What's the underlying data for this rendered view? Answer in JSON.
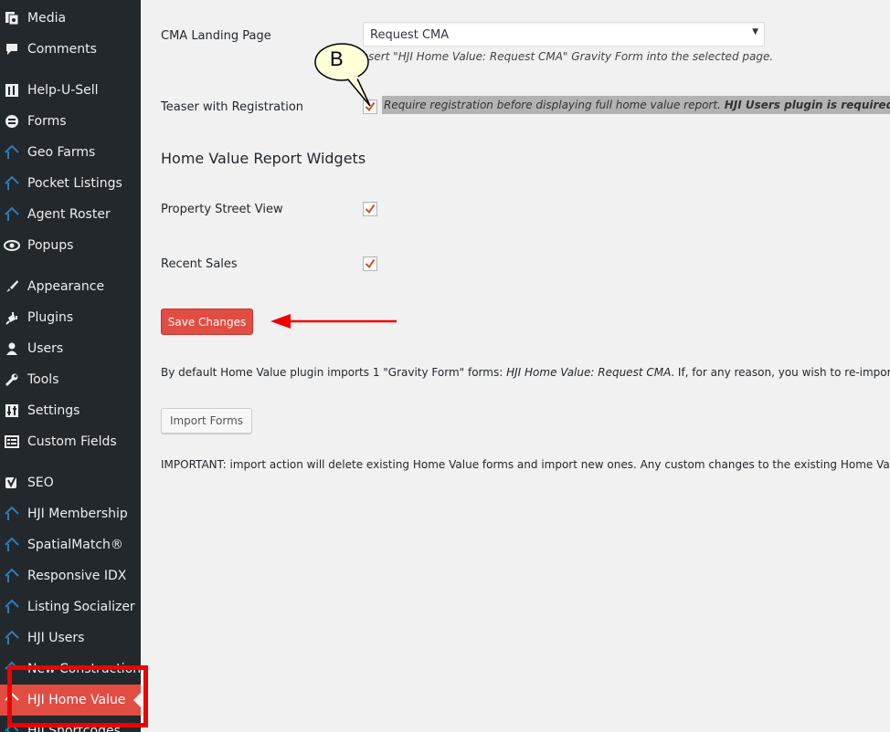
{
  "sidebar": {
    "items": [
      {
        "label": "Media",
        "icon": "media-icon"
      },
      {
        "label": "Comments",
        "icon": "comments-icon"
      },
      {
        "label": "Help-U-Sell",
        "icon": "help-u-sell-icon"
      },
      {
        "label": "Forms",
        "icon": "forms-icon"
      },
      {
        "label": "Geo Farms",
        "icon": "house-icon"
      },
      {
        "label": "Pocket Listings",
        "icon": "house-icon"
      },
      {
        "label": "Agent Roster",
        "icon": "house-icon"
      },
      {
        "label": "Popups",
        "icon": "popups-icon"
      },
      {
        "label": "Appearance",
        "icon": "appearance-icon"
      },
      {
        "label": "Plugins",
        "icon": "plugins-icon"
      },
      {
        "label": "Users",
        "icon": "users-icon"
      },
      {
        "label": "Tools",
        "icon": "tools-icon"
      },
      {
        "label": "Settings",
        "icon": "settings-icon"
      },
      {
        "label": "Custom Fields",
        "icon": "custom-fields-icon"
      },
      {
        "label": "SEO",
        "icon": "seo-icon"
      },
      {
        "label": "HJI Membership",
        "icon": "house-icon"
      },
      {
        "label": "SpatialMatch®",
        "icon": "house-icon"
      },
      {
        "label": "Responsive IDX",
        "icon": "house-icon"
      },
      {
        "label": "Listing Socializer",
        "icon": "house-icon"
      },
      {
        "label": "HJI Users",
        "icon": "house-icon"
      },
      {
        "label": "New Construction",
        "icon": "house-icon"
      },
      {
        "label": "HJI Home Value",
        "icon": "house-icon",
        "active": true
      },
      {
        "label": "HJI Shortcodes",
        "icon": "house-icon"
      }
    ]
  },
  "main": {
    "cma_label": "CMA Landing Page",
    "cma_select_value": "Request CMA",
    "cma_desc": "Insert \"HJI Home Value: Request CMA\" Gravity Form into the selected page.",
    "teaser_label": "Teaser with Registration",
    "teaser_desc_italic": "Require registration before displaying full home value report. ",
    "teaser_desc_bold": "HJI Users plugin is required.",
    "widgets_title": "Home Value Report Widgets",
    "street_view_label": "Property Street View",
    "recent_sales_label": "Recent Sales",
    "save_button": "Save Changes",
    "import_info_prefix": "By default Home Value plugin imports 1 \"Gravity Form\" forms: ",
    "import_info_italic": "HJI Home Value: Request CMA",
    "import_info_suffix": ". If, for any reason, you wish to re-import these",
    "import_button": "Import Forms",
    "important_text": "IMPORTANT: import action will delete existing Home Value forms and import new ones. Any custom changes to the existing Home Valu"
  },
  "annotations": {
    "callout_letter": "B"
  },
  "colors": {
    "sidebar_bg": "#23282d",
    "accent": "#e14d43",
    "annotation_red": "#ee0000",
    "icon_blue": "#2e7db5"
  }
}
